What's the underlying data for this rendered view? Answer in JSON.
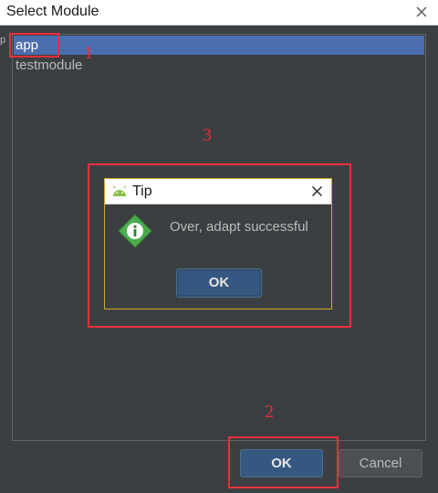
{
  "window": {
    "title": "Select Module"
  },
  "modules": [
    {
      "label": "app",
      "selected": true
    },
    {
      "label": "testmodule",
      "selected": false
    }
  ],
  "edge_glyph": "p",
  "tip_dialog": {
    "title": "Tip",
    "message": "Over, adapt successful",
    "ok_label": "OK"
  },
  "buttons": {
    "ok_label": "OK",
    "cancel_label": "Cancel"
  },
  "annotations": [
    "1",
    "2",
    "3"
  ],
  "colors": {
    "background": "#3c3f41",
    "selection": "#4b6eaf",
    "primary_button": "#365880",
    "annotation_red": "#e8303a",
    "tip_border": "#d6a42a",
    "info_icon_green": "#4caf50"
  }
}
